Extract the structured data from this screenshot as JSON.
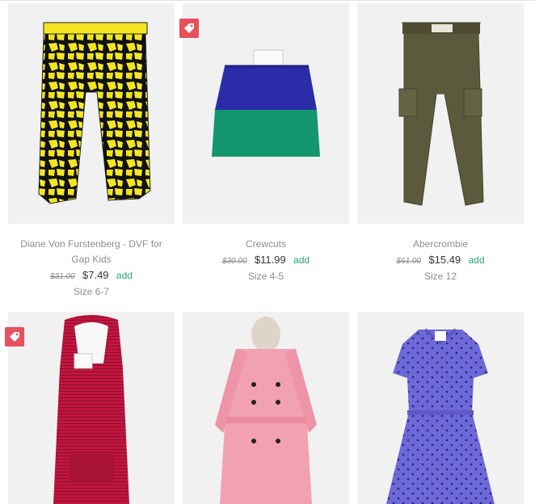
{
  "products": [
    {
      "brand": "Diane Von Furstenberg - DVF for Gap Kids",
      "original_price": "$31.00",
      "price": "$7.49",
      "add_label": "add",
      "size": "Size 6-7",
      "on_sale_badge": false,
      "garment": "yellow-print-capri-pants"
    },
    {
      "brand": "Crewcuts",
      "original_price": "$30.00",
      "price": "$11.99",
      "add_label": "add",
      "size": "Size 4-5",
      "on_sale_badge": true,
      "garment": "blue-green-colorblock-skirt"
    },
    {
      "brand": "Abercrombie",
      "original_price": "$61.00",
      "price": "$15.49",
      "add_label": "add",
      "size": "Size 12",
      "on_sale_badge": false,
      "garment": "olive-cargo-pants"
    },
    {
      "brand": "",
      "original_price": "",
      "price": "",
      "add_label": "",
      "size": "",
      "on_sale_badge": true,
      "garment": "pink-hooded-striped-dress"
    },
    {
      "brand": "",
      "original_price": "",
      "price": "",
      "add_label": "",
      "size": "",
      "on_sale_badge": false,
      "garment": "pink-trench-coat"
    },
    {
      "brand": "",
      "original_price": "",
      "price": "",
      "add_label": "",
      "size": "",
      "on_sale_badge": false,
      "garment": "purple-polka-dot-shirt-dress"
    }
  ],
  "colors": {
    "sale_badge": "#e8505b",
    "add_link": "#2aa574",
    "photo_background": "#f0f0f0"
  },
  "icons": {
    "sale_badge": "tag-icon"
  }
}
